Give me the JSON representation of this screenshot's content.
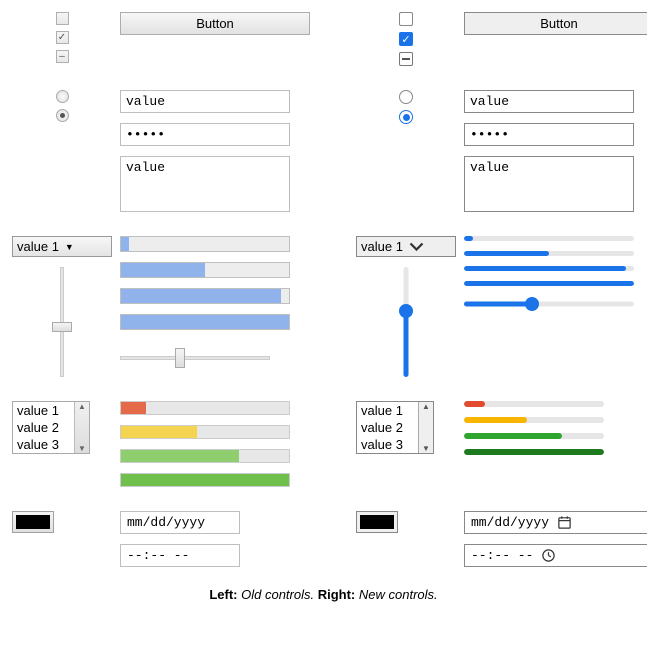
{
  "button_label": "Button",
  "text_value": "value",
  "password_mask": "•••••",
  "textarea_value": "value",
  "select_value": "value 1",
  "listbox": [
    "value 1",
    "value 2",
    "value 3"
  ],
  "date_placeholder": "mm/dd/yyyy",
  "time_placeholder": "--:-- --",
  "caption": {
    "left_label": "Left:",
    "left_text": " Old controls. ",
    "right_label": "Right:",
    "right_text": " New controls."
  },
  "progress_values_pct": [
    5,
    50,
    95,
    100
  ],
  "slider": {
    "vertical_pct": 50,
    "horizontal_pct": 40
  },
  "meters": [
    {
      "color": "#e34b2f",
      "pct": 15
    },
    {
      "color": "#f7b500",
      "pct": 45
    },
    {
      "color": "#2fa52f",
      "pct": 70
    },
    {
      "color": "#1e7a1e",
      "pct": 100
    }
  ],
  "colors": {
    "accent": "#1a73e8",
    "swatch": "#000000"
  }
}
